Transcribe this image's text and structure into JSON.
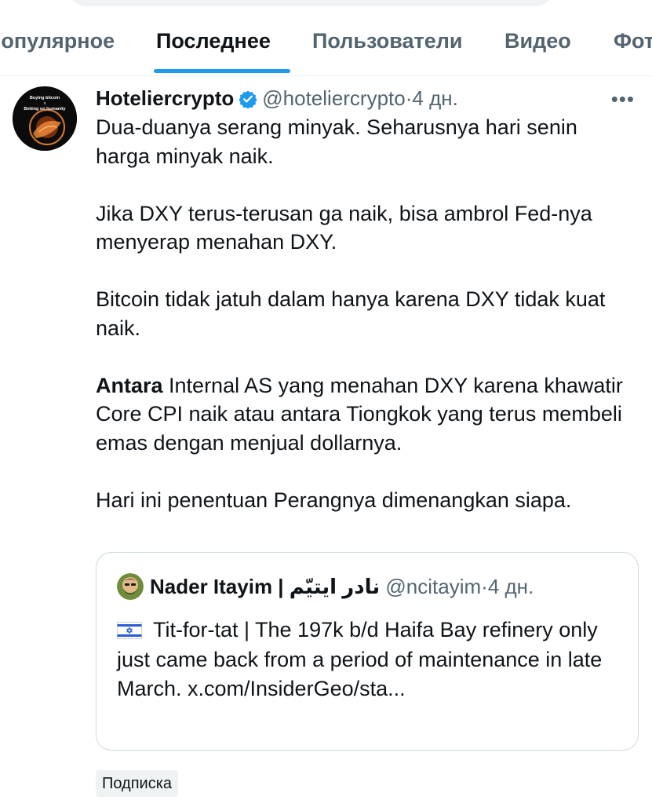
{
  "tabs": [
    {
      "label": "Популярное",
      "active": false
    },
    {
      "label": "Последнее",
      "active": true
    },
    {
      "label": "Пользователи",
      "active": false
    },
    {
      "label": "Видео",
      "active": false
    },
    {
      "label": "Фото",
      "active": false
    }
  ],
  "tweet": {
    "avatar_text_line1": "Buying bitcoin",
    "avatar_text_line2": "x",
    "avatar_text_line3": "Betting on humanity",
    "display_name": "Hoteliercrypto",
    "handle": "@hoteliercrypto",
    "separator": "·",
    "time": "4 дн.",
    "more_icon": "more-icon",
    "paragraphs": [
      "Dua-duanya serang minyak. Seharusnya hari senin harga minyak naik.",
      "Jika DXY terus-terusan ga naik, bisa ambrol Fed-nya menyerap menahan DXY.",
      "Bitcoin tidak jatuh dalam hanya karena DXY tidak kuat naik."
    ],
    "paragraph4_bold": "Antara",
    "paragraph4_rest": " Internal AS yang menahan DXY karena khawatir Core CPI naik atau antara Tiongkok yang terus membeli emas dengan menjual dollarnya.",
    "paragraph5": "Hari ini penentuan Perangnya dimenangkan siapa.",
    "verified_color": "#1d9bf0"
  },
  "quote": {
    "display_name": "Nader Itayim | نادر ايتيّم",
    "handle": "@ncitayim",
    "separator": "·",
    "time": "4 дн.",
    "text": "Tit-for-tat | The 197k b/d Haifa Bay refinery only just came back from a period of maintenance in late March. x.com/InsiderGeo/sta..."
  },
  "subscribe_label": "Подписка",
  "colors": {
    "accent": "#1d9bf0",
    "secondary_text": "#536471",
    "border": "#cfd9de"
  }
}
